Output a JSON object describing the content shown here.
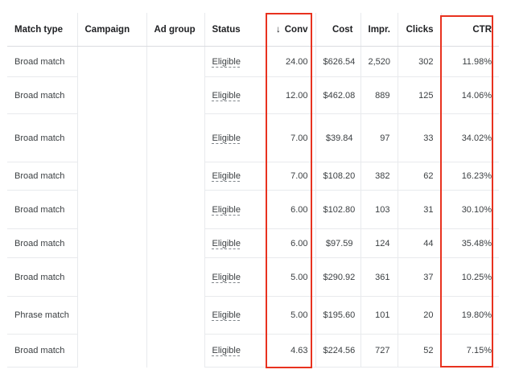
{
  "columns": {
    "match_type": "Match type",
    "campaign": "Campaign",
    "ad_group": "Ad group",
    "status": "Status",
    "conv": "Conv",
    "cost": "Cost",
    "impr": "Impr.",
    "clicks": "Clicks",
    "ctr": "CTR"
  },
  "sort": {
    "column": "conv",
    "direction": "descending",
    "icon": "arrow-down-icon",
    "glyph": "↓"
  },
  "highlight_color": "#e8321f",
  "rows": [
    {
      "match_type": "Broad match",
      "status": "Eligible",
      "conv": "24.00",
      "cost": "$626.54",
      "impr": "2,520",
      "clicks": "302",
      "ctr": "11.98%"
    },
    {
      "match_type": "Broad match",
      "status": "Eligible",
      "conv": "12.00",
      "cost": "$462.08",
      "impr": "889",
      "clicks": "125",
      "ctr": "14.06%"
    },
    {
      "match_type": "Broad match",
      "status": "Eligible",
      "conv": "7.00",
      "cost": "$39.84",
      "impr": "97",
      "clicks": "33",
      "ctr": "34.02%"
    },
    {
      "match_type": "Broad match",
      "status": "Eligible",
      "conv": "7.00",
      "cost": "$108.20",
      "impr": "382",
      "clicks": "62",
      "ctr": "16.23%"
    },
    {
      "match_type": "Broad match",
      "status": "Eligible",
      "conv": "6.00",
      "cost": "$102.80",
      "impr": "103",
      "clicks": "31",
      "ctr": "30.10%"
    },
    {
      "match_type": "Broad match",
      "status": "Eligible",
      "conv": "6.00",
      "cost": "$97.59",
      "impr": "124",
      "clicks": "44",
      "ctr": "35.48%"
    },
    {
      "match_type": "Broad match",
      "status": "Eligible",
      "conv": "5.00",
      "cost": "$290.92",
      "impr": "361",
      "clicks": "37",
      "ctr": "10.25%"
    },
    {
      "match_type": "Phrase match",
      "status": "Eligible",
      "conv": "5.00",
      "cost": "$195.60",
      "impr": "101",
      "clicks": "20",
      "ctr": "19.80%"
    },
    {
      "match_type": "Broad match",
      "status": "Eligible",
      "conv": "4.63",
      "cost": "$224.56",
      "impr": "727",
      "clicks": "52",
      "ctr": "7.15%"
    }
  ]
}
